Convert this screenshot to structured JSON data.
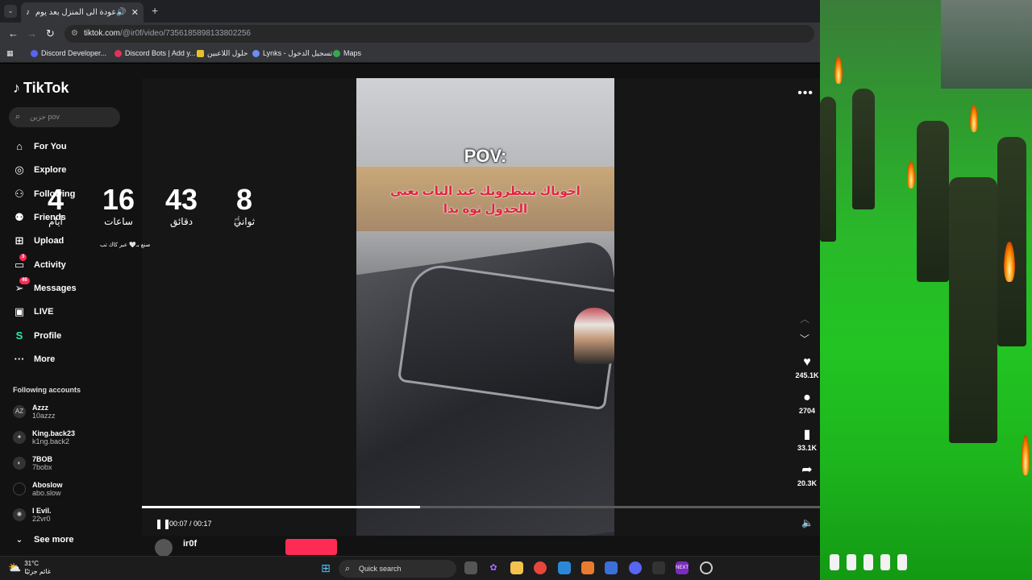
{
  "browser": {
    "tab_title": "عودة الى المنزل بعد يوم طو",
    "tab_audio_icon": "speaker-icon",
    "url_host": "tiktok.com",
    "url_path": "/@ir0f/video/7356185898133802256",
    "bookmarks": [
      {
        "label": "Discord Developer...",
        "color": "#5865f2"
      },
      {
        "label": "Discord Bots | Add y...",
        "color": "#e2335a"
      },
      {
        "label": "حلول اللاعبين",
        "color": "#e7c12b"
      },
      {
        "label": "Lynks - تسجيل الدخول",
        "color": "#6f8cf6"
      },
      {
        "label": "Maps",
        "color": "#34a853"
      }
    ]
  },
  "tiktok": {
    "logo": "TikTok",
    "search_placeholder": "حزين pov",
    "nav": [
      {
        "label": "For You",
        "icon": "home-icon"
      },
      {
        "label": "Explore",
        "icon": "compass-icon"
      },
      {
        "label": "Following",
        "icon": "following-icon"
      },
      {
        "label": "Friends",
        "icon": "friends-icon"
      },
      {
        "label": "Upload",
        "icon": "upload-icon"
      },
      {
        "label": "Activity",
        "icon": "activity-icon",
        "badge": "3"
      },
      {
        "label": "Messages",
        "icon": "messages-icon",
        "badge": "46"
      },
      {
        "label": "LIVE",
        "icon": "live-icon"
      },
      {
        "label": "Profile",
        "icon": "profile-icon"
      },
      {
        "label": "More",
        "icon": "more-icon"
      }
    ],
    "following_title": "Following accounts",
    "accounts": [
      {
        "name": "Azzz",
        "handle": "10azzz"
      },
      {
        "name": "King.back23",
        "handle": "k1ng.back2"
      },
      {
        "name": "7BOB",
        "handle": "7bobx"
      },
      {
        "name": "Aboslow",
        "handle": "abo.slow"
      },
      {
        "name": "I Evil.",
        "handle": "22vr0"
      }
    ],
    "see_more": "See more",
    "video": {
      "caption_title": "POV:",
      "caption_line1": "اخوياك ينتظرونك عند الباب يعني",
      "caption_line2": "الجدول توه بدا",
      "current_time": "00:07 / 00:17",
      "progress_fraction": 0.41,
      "likes": "245.1K",
      "comments": "2704",
      "saves": "33.1K",
      "shares": "20.3K",
      "author": "ir0f"
    }
  },
  "countdown": {
    "days": "4",
    "days_label": "أيام",
    "hours": "16",
    "hours_label": "ساعات",
    "minutes": "43",
    "minutes_label": "دقائق",
    "seconds": "8",
    "seconds_label": "ثواني",
    "credit": "صنع بـ🤍 عبر كاك تب"
  },
  "taskbar": {
    "temperature": "31°C",
    "weather_text": "غائم جزئيًا",
    "search_label": "Quick search"
  }
}
